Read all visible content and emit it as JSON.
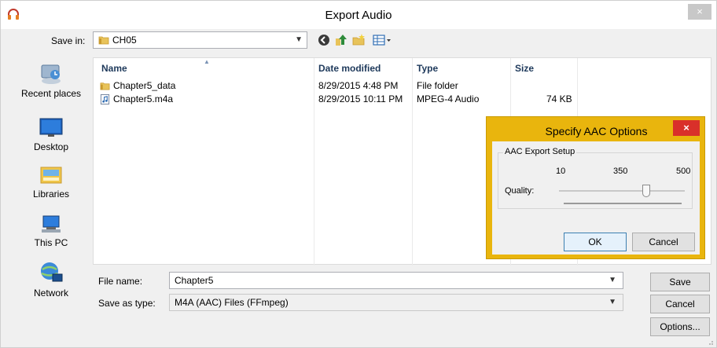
{
  "window": {
    "title": "Export Audio",
    "close_glyph": "×"
  },
  "toolbar": {
    "save_in_label": "Save in:",
    "save_in_value": "CH05",
    "icons": [
      "back-icon",
      "up-folder-icon",
      "new-folder-icon",
      "view-menu-icon"
    ]
  },
  "places": [
    {
      "label": "Recent places",
      "icon": "recent-places-icon"
    },
    {
      "label": "Desktop",
      "icon": "desktop-icon"
    },
    {
      "label": "Libraries",
      "icon": "libraries-icon"
    },
    {
      "label": "This PC",
      "icon": "this-pc-icon"
    },
    {
      "label": "Network",
      "icon": "network-icon"
    }
  ],
  "file_list": {
    "columns": [
      "Name",
      "Date modified",
      "Type",
      "Size"
    ],
    "rows": [
      {
        "name": "Chapter5_data",
        "date": "8/29/2015 4:48 PM",
        "type": "File folder",
        "size": "",
        "icon": "folder-icon"
      },
      {
        "name": "Chapter5.m4a",
        "date": "8/29/2015 10:11 PM",
        "type": "MPEG-4 Audio",
        "size": "74 KB",
        "icon": "audio-file-icon"
      }
    ]
  },
  "aac_dialog": {
    "title": "Specify AAC Options",
    "close_glyph": "×",
    "group_label": "AAC Export Setup",
    "ticks": [
      "10",
      "350",
      "500"
    ],
    "quality_label": "Quality:",
    "quality_min": 10,
    "quality_max": 500,
    "quality_value": 350,
    "ok_label": "OK",
    "cancel_label": "Cancel"
  },
  "form": {
    "file_name_label": "File name:",
    "file_name_value": "Chapter5",
    "save_as_type_label": "Save as type:",
    "save_as_type_value": "M4A (AAC) Files (FFmpeg)"
  },
  "buttons": {
    "save": "Save",
    "cancel": "Cancel",
    "options": "Options..."
  },
  "colors": {
    "aac_frame": "#e9b50d",
    "aac_close": "#d9302a",
    "header_text": "#1e395b"
  }
}
